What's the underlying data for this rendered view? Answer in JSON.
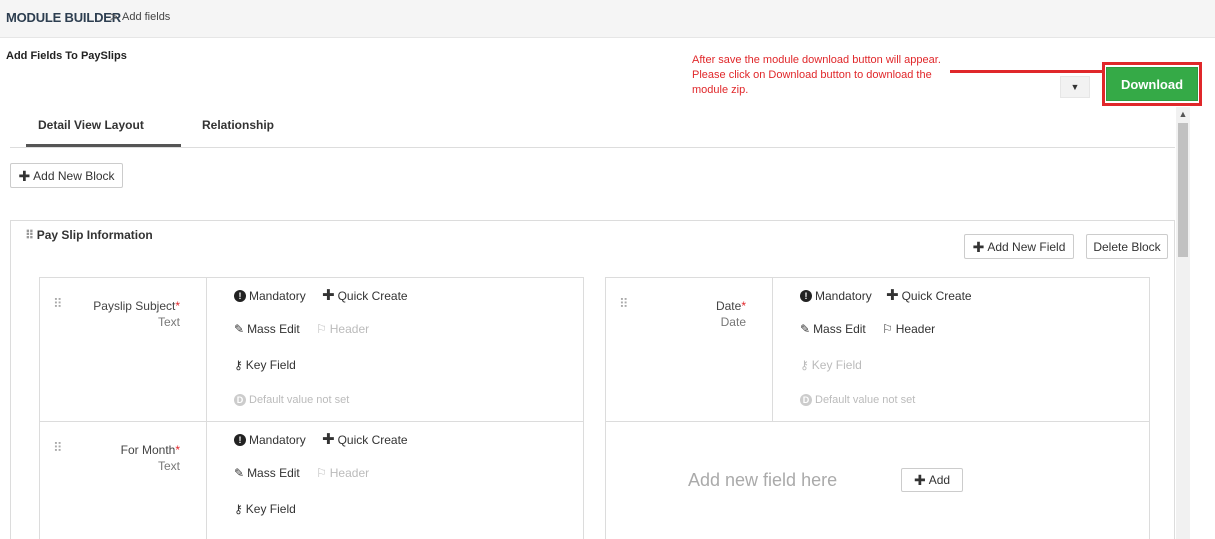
{
  "breadcrumb": {
    "main": "MODULE BUILDER",
    "separator": ">",
    "sub": "Add fields"
  },
  "page_title": "Add Fields To PaySlips",
  "annotation": {
    "text": "After save the module download button will appear. Please click on Download button to download the module zip."
  },
  "download_button": "Download",
  "tabs": [
    {
      "label": "Detail View Layout",
      "active": true
    },
    {
      "label": "Relationship",
      "active": false
    }
  ],
  "add_new_block": "Add New Block",
  "block": {
    "title": "Pay Slip Information",
    "add_new_field": "Add New Field",
    "delete_block": "Delete Block"
  },
  "fields": [
    {
      "name": "Payslip Subject",
      "required_mark": "*",
      "type": "Text",
      "mandatory": "Mandatory",
      "quick_create": "Quick Create",
      "mass_edit": "Mass Edit",
      "header": "Header",
      "key_field": "Key Field",
      "default_value": "Default value not set"
    },
    {
      "name": "Date",
      "required_mark": "*",
      "type": "Date",
      "mandatory": "Mandatory",
      "quick_create": "Quick Create",
      "mass_edit": "Mass Edit",
      "header": "Header",
      "key_field": "Key Field",
      "default_value": "Default value not set"
    },
    {
      "name": "For Month",
      "required_mark": "*",
      "type": "Text",
      "mandatory": "Mandatory",
      "quick_create": "Quick Create",
      "mass_edit": "Mass Edit",
      "header": "Header",
      "key_field": "Key Field"
    }
  ],
  "add_field_placeholder": {
    "text": "Add new field here",
    "button": "Add"
  },
  "colors": {
    "download_green": "#35aa47",
    "annotation_red": "#e0272a",
    "required_red": "#e0272a"
  }
}
